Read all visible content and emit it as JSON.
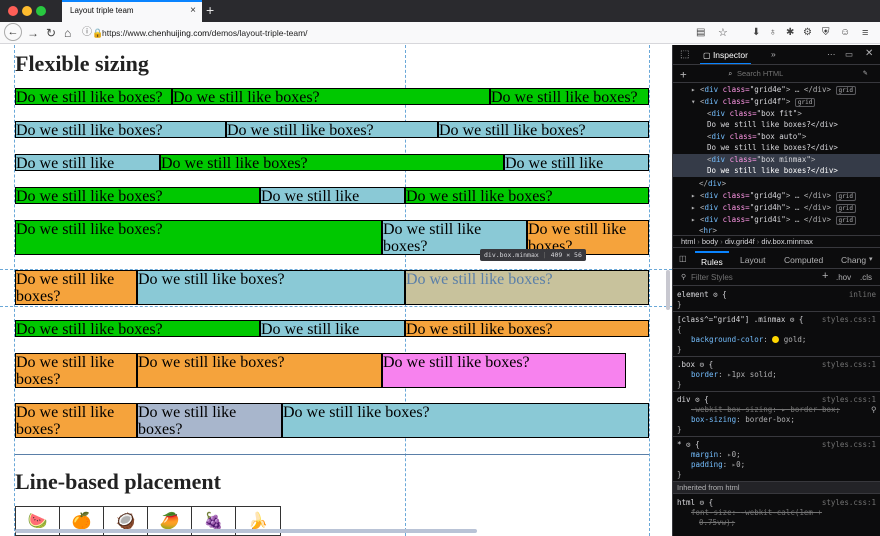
{
  "browser": {
    "tab_title": "Layout triple team",
    "tab_close": "×",
    "new_tab": "+",
    "url_prefix": "https://www.",
    "url_host": "chenhuijing.com",
    "url_path": "/demos/layout-triple-team/"
  },
  "page": {
    "heading_flex": "Flexible sizing",
    "heading_line": "Line-based placement",
    "box_text": "Do we still like boxes?",
    "tooltip_selector": "div.box.minmax",
    "tooltip_size": "409 × 56",
    "fruits": [
      "🍉",
      "🍊",
      "🥥",
      "🥭",
      "🍇",
      "🍌"
    ]
  },
  "devtools": {
    "tab_inspector": "Inspector",
    "tab_more": "»",
    "search_placeholder": "Search HTML",
    "tree": [
      {
        "pre": "▸ <",
        "tag": "div",
        "attr": " class=",
        "val": "\"grid4e\"",
        "post": "> … </div>",
        "badge": "grid"
      },
      {
        "pre": "▾ <",
        "tag": "div",
        "attr": " class=",
        "val": "\"grid4f\"",
        "post": ">",
        "badge": "grid"
      },
      {
        "pre": "<",
        "tag": "div",
        "attr": " class=",
        "val": "\"box fit\"",
        "post": ">",
        "badge": ""
      },
      {
        "pre": "",
        "tag": "",
        "attr": "",
        "val": "",
        "post": "Do we still like boxes?</div>",
        "badge": ""
      },
      {
        "pre": "<",
        "tag": "div",
        "attr": " class=",
        "val": "\"box auto\"",
        "post": ">",
        "badge": ""
      },
      {
        "pre": "",
        "tag": "",
        "attr": "",
        "val": "",
        "post": "Do we still like boxes?</div>",
        "badge": ""
      },
      {
        "pre": "<",
        "tag": "div",
        "attr": " class=",
        "val": "\"box minmax\"",
        "post": ">",
        "badge": ""
      },
      {
        "pre": "",
        "tag": "",
        "attr": "",
        "val": "",
        "post": "Do we still like boxes?</div>",
        "badge": ""
      },
      {
        "pre": "</",
        "tag": "div",
        "attr": "",
        "val": "",
        "post": ">",
        "badge": ""
      },
      {
        "pre": "▸ <",
        "tag": "div",
        "attr": " class=",
        "val": "\"grid4g\"",
        "post": "> … </div>",
        "badge": "grid"
      },
      {
        "pre": "▸ <",
        "tag": "div",
        "attr": " class=",
        "val": "\"grid4h\"",
        "post": "> … </div>",
        "badge": "grid"
      },
      {
        "pre": "▸ <",
        "tag": "div",
        "attr": " class=",
        "val": "\"grid4i\"",
        "post": "> … </div>",
        "badge": "grid"
      },
      {
        "pre": "<",
        "tag": "hr",
        "attr": "",
        "val": "",
        "post": ">",
        "badge": ""
      }
    ],
    "breadcrumbs": [
      "html",
      "body",
      "div.grid4f",
      "div.box.minmax"
    ],
    "subtabs": [
      "Rules",
      "Layout",
      "Computed",
      "Chang"
    ],
    "filter_placeholder": "Filter Styles",
    "hov": ".hov",
    "cls": ".cls",
    "rules": {
      "element_sel": "element",
      "element_src": "inline",
      "r1_sel": "[class^=\"grid4\"] .minmax",
      "r1_src": "styles.css:1",
      "r1_prop": "background-color",
      "r1_val": "gold;",
      "r2_sel": ".box",
      "r2_src": "styles.css:1",
      "r2_prop": "border",
      "r2_val": "1px solid;",
      "r3_sel": "div",
      "r3_src": "styles.css:1",
      "r3_prop1": "-webkit-box-sizing",
      "r3_val1": "border-box;",
      "r3_prop2": "box-sizing",
      "r3_val2": "border-box;",
      "r4_sel": "*",
      "r4_src": "styles.css:1",
      "r4_prop1": "margin",
      "r4_val1": "0;",
      "r4_prop2": "padding",
      "r4_val2": "0;",
      "inherited": "Inherited from html",
      "r5_sel": "html",
      "r5_src": "styles.css:1",
      "r5_prop": "font-size",
      "r5_val": "-webkit-calc(1em +",
      "r5_val2": "0.75vw);",
      "open_brace": "{",
      "close_brace": "}"
    }
  },
  "colors": {
    "green": "#00c800",
    "blue": "#8ac9d6",
    "orange": "#f5a33c",
    "pink": "#f782ee",
    "gold": "#ffd700"
  }
}
